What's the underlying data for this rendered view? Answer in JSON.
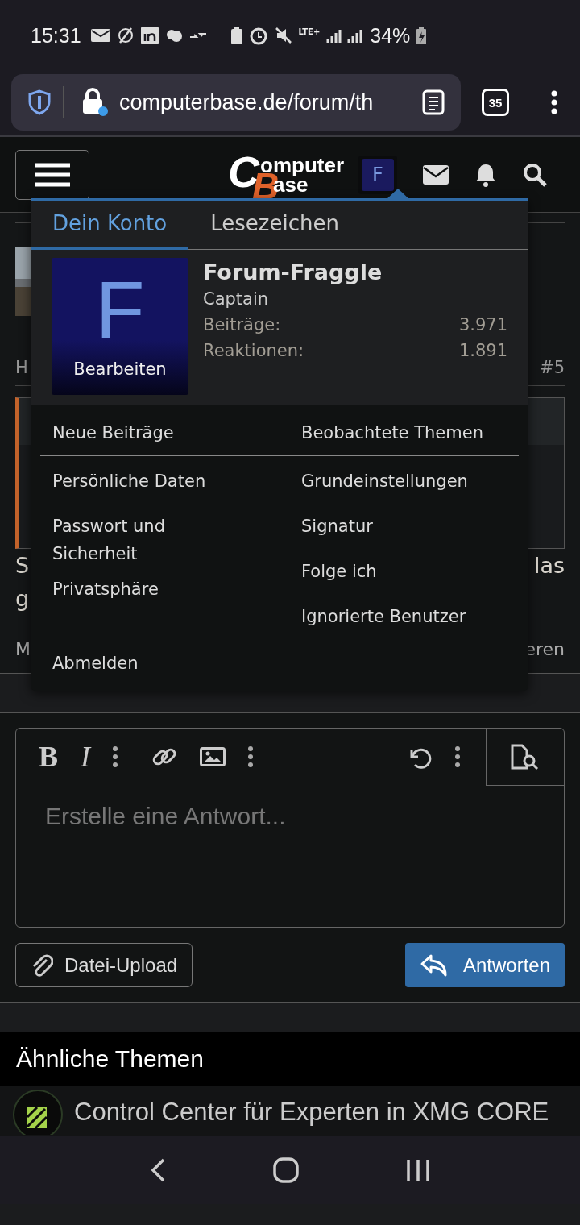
{
  "status_bar": {
    "time": "15:31",
    "network": "LTE+",
    "battery": "34%"
  },
  "browser": {
    "url": "computerbase.de/forum/th",
    "tab_count": "35"
  },
  "header": {
    "logo": {
      "big_1": "C",
      "rest_1": "omputer",
      "big_2": "B",
      "rest_2": "ase"
    },
    "avatar_letter": "F"
  },
  "post": {
    "header_start": "H",
    "post_number": "#5",
    "line_1_start": "S",
    "line_1_end": "las",
    "line_2_start": "g",
    "footer_start": "M",
    "footer_end": "eren"
  },
  "account_menu": {
    "tabs": [
      {
        "label": "Dein Konto",
        "selected": true
      },
      {
        "label": "Lesezeichen",
        "selected": false
      }
    ],
    "avatar_letter": "F",
    "edit_label": "Bearbeiten",
    "name": "Forum-Fraggle",
    "rank": "Captain",
    "stats": [
      {
        "label": "Beiträge:",
        "value": "3.971"
      },
      {
        "label": "Reaktionen:",
        "value": "1.891"
      }
    ],
    "top_links": [
      "Neue Beiträge",
      "Beobachtete Themen"
    ],
    "left_links": [
      "Persönliche Daten",
      "Passwort und Sicherheit",
      "Privatsphäre"
    ],
    "right_links": [
      "Grundeinstellungen",
      "Signatur",
      "Folge ich",
      "Ignorierte Benutzer"
    ],
    "logout": "Abmelden"
  },
  "editor": {
    "bold": "B",
    "italic": "I",
    "placeholder": "Erstelle eine Antwort...",
    "upload": "Datei-Upload",
    "reply": "Antworten"
  },
  "similar": {
    "heading": "Ähnliche Themen",
    "items": [
      {
        "title": "Control Center für Experten in XMG CORE"
      }
    ]
  }
}
